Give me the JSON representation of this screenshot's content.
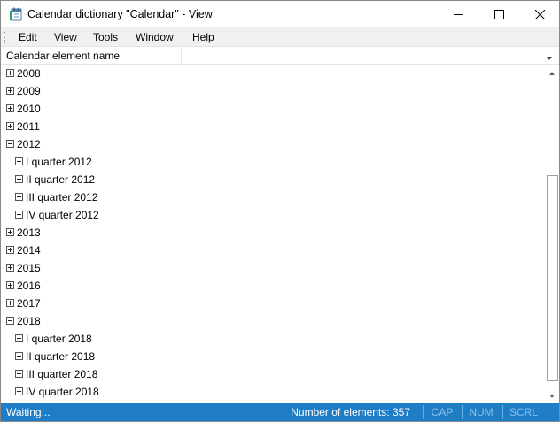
{
  "window": {
    "title": "Calendar dictionary \"Calendar\" - View"
  },
  "menu": {
    "items": [
      {
        "label": "Edit"
      },
      {
        "label": "View"
      },
      {
        "label": "Tools"
      },
      {
        "label": "Window"
      },
      {
        "label": "Help"
      }
    ]
  },
  "column_header": {
    "title": "Calendar element name"
  },
  "tree": {
    "rows": [
      {
        "label": "2008",
        "level": 0,
        "state": "collapsed"
      },
      {
        "label": "2009",
        "level": 0,
        "state": "collapsed"
      },
      {
        "label": "2010",
        "level": 0,
        "state": "collapsed"
      },
      {
        "label": "2011",
        "level": 0,
        "state": "collapsed"
      },
      {
        "label": "2012",
        "level": 0,
        "state": "expanded"
      },
      {
        "label": "I quarter 2012",
        "level": 1,
        "state": "collapsed"
      },
      {
        "label": "II quarter 2012",
        "level": 1,
        "state": "collapsed"
      },
      {
        "label": "III quarter 2012",
        "level": 1,
        "state": "collapsed"
      },
      {
        "label": "IV quarter 2012",
        "level": 1,
        "state": "collapsed"
      },
      {
        "label": "2013",
        "level": 0,
        "state": "collapsed"
      },
      {
        "label": "2014",
        "level": 0,
        "state": "collapsed"
      },
      {
        "label": "2015",
        "level": 0,
        "state": "collapsed"
      },
      {
        "label": "2016",
        "level": 0,
        "state": "collapsed"
      },
      {
        "label": "2017",
        "level": 0,
        "state": "collapsed"
      },
      {
        "label": "2018",
        "level": 0,
        "state": "expanded"
      },
      {
        "label": "I quarter 2018",
        "level": 1,
        "state": "collapsed"
      },
      {
        "label": "II quarter 2018",
        "level": 1,
        "state": "collapsed"
      },
      {
        "label": "III quarter 2018",
        "level": 1,
        "state": "collapsed"
      },
      {
        "label": "IV quarter 2018",
        "level": 1,
        "state": "collapsed"
      }
    ]
  },
  "scrollbar": {
    "thumb_start_fraction": 0.31,
    "thumb_end_fraction": 0.98
  },
  "statusbar": {
    "status_text": "Waiting...",
    "count_text": "Number of elements: 357",
    "indicators": [
      "CAP",
      "NUM",
      "SCRL"
    ],
    "background_color": "#1f7dc6"
  },
  "icons": {
    "app": "calendar-dictionary-icon",
    "minimize": "minimize-icon",
    "maximize": "maximize-icon",
    "close": "close-icon",
    "expand": "plus-box-icon",
    "collapse": "minus-box-icon",
    "scroll_up": "chevron-up-icon",
    "scroll_down": "chevron-down-icon",
    "header_dropdown": "dropdown-arrow-icon"
  }
}
